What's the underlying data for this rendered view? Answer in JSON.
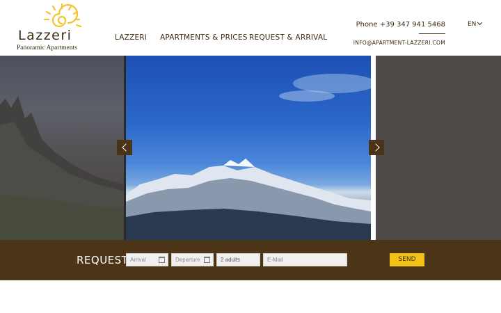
{
  "brand": {
    "name": "Lazzeri",
    "tagline": "Panoramic Apartments"
  },
  "nav": {
    "items": [
      {
        "label": "LAZZERI"
      },
      {
        "label": "APARTMENTS & PRICES"
      },
      {
        "label": "REQUEST & ARRIVAL"
      }
    ]
  },
  "contact": {
    "phone": "Phone +39 347 941 5468",
    "email": "INFO@APARTMENT-LAZZERI.COM"
  },
  "language": {
    "selected": "EN"
  },
  "slider": {
    "prev_icon": "chevron-left-icon",
    "next_icon": "chevron-right-icon"
  },
  "request": {
    "label": "REQUEST:",
    "arrival_placeholder": "Arrival",
    "departure_placeholder": "Departure",
    "guests_value": "2 adults",
    "email_placeholder": "E-Mail",
    "send_label": "SEND"
  },
  "colors": {
    "brand_brown": "#4c3418",
    "accent_yellow": "#f2c316",
    "sun_yellow": "#f4c430"
  }
}
